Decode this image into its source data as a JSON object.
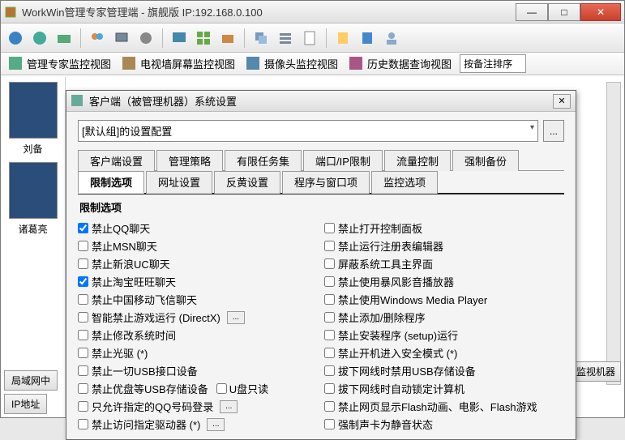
{
  "title": "WorkWin管理专家管理端 - 旗舰版 IP:192.168.0.100",
  "viewbar": {
    "v1": "管理专家监控视图",
    "v2": "电视墙屏幕监控视图",
    "v3": "摄像头监控视图",
    "v4": "历史数据查询视图",
    "sort": "按备注排序"
  },
  "left": {
    "name1": "刘备",
    "name2": "诸葛亮",
    "btn1": "局域网中",
    "btn2": "IP地址"
  },
  "right_btn": "监视机器",
  "dialog": {
    "title": "客户端（被管理机器）系统设置",
    "combo": "[默认组]的设置配置",
    "browse": "...",
    "tabs1": [
      "客户端设置",
      "管理策略",
      "有限任务集",
      "端口/IP限制",
      "流量控制",
      "强制备份"
    ],
    "tabs2": [
      "限制选项",
      "网址设置",
      "反黄设置",
      "程序与窗口项",
      "监控选项"
    ],
    "active_tab": "限制选项",
    "group": "限制选项",
    "left_opts": [
      {
        "label": "禁止QQ聊天",
        "checked": true
      },
      {
        "label": "禁止MSN聊天",
        "checked": false
      },
      {
        "label": "禁止新浪UC聊天",
        "checked": false
      },
      {
        "label": "禁止淘宝旺旺聊天",
        "checked": true
      },
      {
        "label": "禁止中国移动飞信聊天",
        "checked": false
      },
      {
        "label": "智能禁止游戏运行 (DirectX)",
        "checked": false,
        "btn": true
      },
      {
        "label": "禁止修改系统时间",
        "checked": false
      },
      {
        "label": "禁止光驱 (*)",
        "checked": false
      },
      {
        "label": "禁止一切USB接口设备",
        "checked": false
      },
      {
        "label": "禁止优盘等USB存储设备",
        "checked": false,
        "extra": "U盘只读"
      },
      {
        "label": "只允许指定的QQ号码登录",
        "checked": false,
        "btn": true
      },
      {
        "label": "禁止访问指定驱动器 (*)",
        "checked": false,
        "btn": true
      }
    ],
    "right_opts": [
      {
        "label": "禁止打开控制面板",
        "checked": false
      },
      {
        "label": "禁止运行注册表编辑器",
        "checked": false
      },
      {
        "label": "屏蔽系统工具主界面",
        "checked": false
      },
      {
        "label": "禁止使用暴风影音播放器",
        "checked": false
      },
      {
        "label": "禁止使用Windows Media Player",
        "checked": false
      },
      {
        "label": "禁止添加/删除程序",
        "checked": false
      },
      {
        "label": "禁止安装程序 (setup)运行",
        "checked": false
      },
      {
        "label": "禁止开机进入安全模式 (*)",
        "checked": false
      },
      {
        "label": "拔下网线时禁用USB存储设备",
        "checked": false
      },
      {
        "label": "拔下网线时自动锁定计算机",
        "checked": false
      },
      {
        "label": "禁止网页显示Flash动画、电影、Flash游戏",
        "checked": false
      },
      {
        "label": "强制声卡为静音状态",
        "checked": false
      }
    ]
  }
}
